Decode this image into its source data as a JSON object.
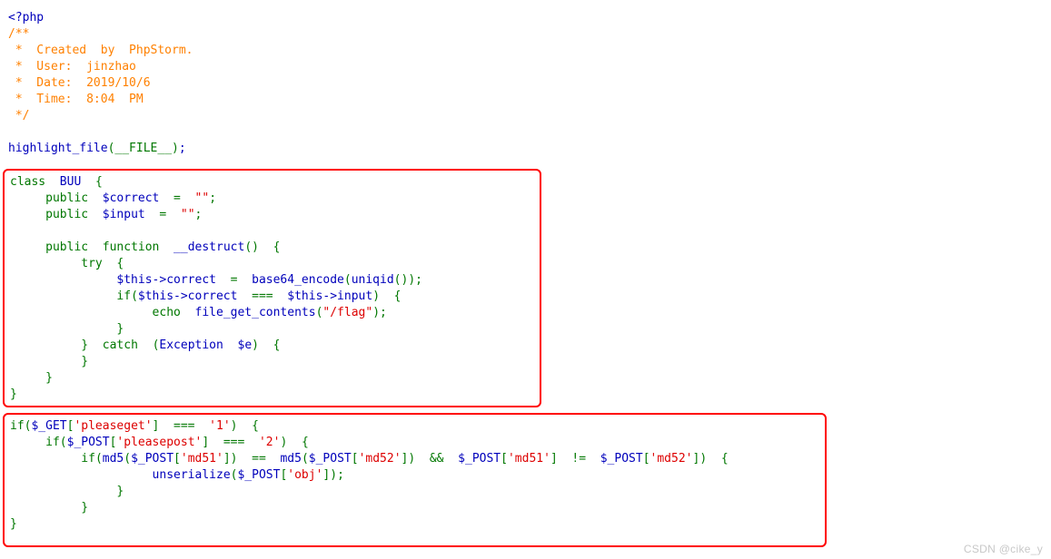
{
  "page": {
    "type": "php-source-highlight-output",
    "background_color": "#ffffff",
    "box_border_color": "#ff0000"
  },
  "colors": {
    "default": "#0000bb",
    "keyword": "#007700",
    "string": "#dd0000",
    "comment": "#ff8000",
    "watermark": "#c8c8c8"
  },
  "intro": {
    "open_tag": "<?php",
    "docblock": [
      "/**",
      " *  Created  by  PhpStorm.",
      " *  User:  jinzhao",
      " *  Date:  2019/10/6",
      " *  Time:  8:04  PM",
      " */"
    ],
    "meta": {
      "created_by": "PhpStorm",
      "user": "jinzhao",
      "date": "2019/10/6",
      "time": "8:04  PM"
    },
    "highlight_call": {
      "function": "highlight_file",
      "open_paren": "(",
      "argument": "__FILE__",
      "close_paren": ")",
      "semicolon": ";"
    }
  },
  "class_block": {
    "keyword_class": "class",
    "class_name": "BUU",
    "open_brace": "{",
    "properties": [
      {
        "visibility": "public",
        "name": "$correct",
        "assign": "=",
        "value": "\"\"",
        "semicolon": ";"
      },
      {
        "visibility": "public",
        "name": "$input",
        "assign": "=",
        "value": "\"\"",
        "semicolon": ";"
      }
    ],
    "method": {
      "visibility": "public",
      "keyword_function": "function",
      "name": "__destruct",
      "parens": "()",
      "open_brace": "{",
      "try_keyword": "try",
      "body": [
        {
          "target": "$this->correct",
          "assign": "=",
          "call_fn": "base64_encode",
          "inner_fn": "uniqid",
          "statement": "$this->correct  =  base64_encode(uniqid());"
        },
        {
          "if_keyword": "if",
          "left": "$this->correct",
          "operator": "===",
          "right": "$this->input",
          "statement": "if($this->correct  ===  $this->input)  {"
        },
        {
          "echo_keyword": "echo",
          "call_fn": "file_get_contents",
          "arg_string": "\"/flag\"",
          "statement": "echo  file_get_contents(\"/flag\");"
        }
      ],
      "catch_keyword": "catch",
      "exception_type": "Exception",
      "exception_var": "$e"
    },
    "close_brace": "}"
  },
  "logic_block": {
    "lines": [
      {
        "if_keyword": "if",
        "superglobal": "$_GET",
        "key": "'pleaseget'",
        "operator": "===",
        "value": "'1'",
        "trail": "{"
      },
      {
        "if_keyword": "if",
        "superglobal": "$_POST",
        "key": "'pleasepost'",
        "operator": "===",
        "value": "'2'",
        "trail": "{"
      },
      {
        "if_keyword": "if",
        "hash_fn": "md5",
        "left_key": "'md51'",
        "operator_hash": "==",
        "right_key": "'md52'",
        "logic_operator": "&&",
        "operator_raw": "!=",
        "trail": "{"
      },
      {
        "call_fn": "unserialize",
        "superglobal": "$_POST",
        "key": "'obj'",
        "semicolon": ";"
      }
    ],
    "closing_braces": [
      "}",
      "}",
      "}"
    ]
  },
  "watermark": {
    "text": "CSDN @cike_y"
  }
}
